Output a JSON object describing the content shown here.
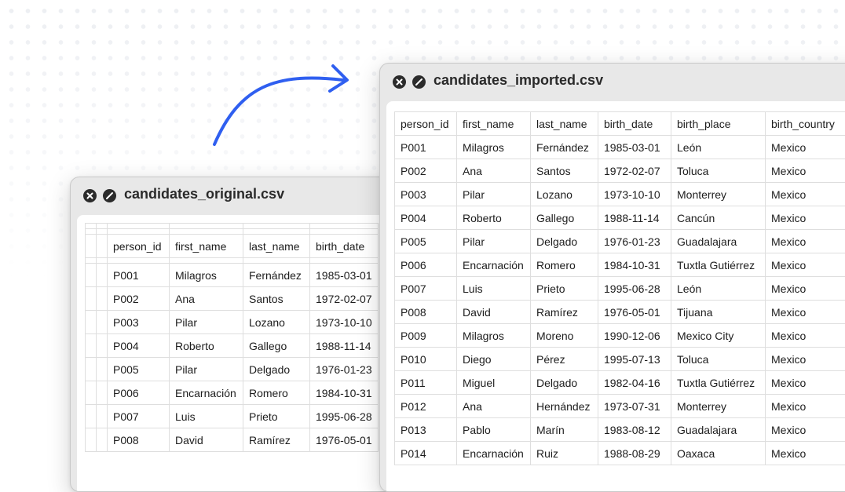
{
  "original": {
    "title": "candidates_original.csv",
    "columns": [
      "person_id",
      "first_name",
      "last_name",
      "birth_date"
    ],
    "rows": [
      [
        "P001",
        "Milagros",
        "Fernández",
        "1985-03-01"
      ],
      [
        "P002",
        "Ana",
        "Santos",
        "1972-02-07"
      ],
      [
        "P003",
        "Pilar",
        "Lozano",
        "1973-10-10"
      ],
      [
        "P004",
        "Roberto",
        "Gallego",
        "1988-11-14"
      ],
      [
        "P005",
        "Pilar",
        "Delgado",
        "1976-01-23"
      ],
      [
        "P006",
        "Encarnación",
        "Romero",
        "1984-10-31"
      ],
      [
        "P007",
        "Luis",
        "Prieto",
        "1995-06-28"
      ],
      [
        "P008",
        "David",
        "Ramírez",
        "1976-05-01"
      ]
    ]
  },
  "imported": {
    "title": "candidates_imported.csv",
    "columns": [
      "person_id",
      "first_name",
      "last_name",
      "birth_date",
      "birth_place",
      "birth_country"
    ],
    "rows": [
      [
        "P001",
        "Milagros",
        "Fernández",
        "1985-03-01",
        "León",
        "Mexico"
      ],
      [
        "P002",
        "Ana",
        "Santos",
        "1972-02-07",
        "Toluca",
        "Mexico"
      ],
      [
        "P003",
        "Pilar",
        "Lozano",
        "1973-10-10",
        "Monterrey",
        "Mexico"
      ],
      [
        "P004",
        "Roberto",
        "Gallego",
        "1988-11-14",
        "Cancún",
        "Mexico"
      ],
      [
        "P005",
        "Pilar",
        "Delgado",
        "1976-01-23",
        "Guadalajara",
        "Mexico"
      ],
      [
        "P006",
        "Encarnación",
        "Romero",
        "1984-10-31",
        "Tuxtla Gutiérrez",
        "Mexico"
      ],
      [
        "P007",
        "Luis",
        "Prieto",
        "1995-06-28",
        "León",
        "Mexico"
      ],
      [
        "P008",
        "David",
        "Ramírez",
        "1976-05-01",
        "Tijuana",
        "Mexico"
      ],
      [
        "P009",
        "Milagros",
        "Moreno",
        "1990-12-06",
        "Mexico City",
        "Mexico"
      ],
      [
        "P010",
        "Diego",
        "Pérez",
        "1995-07-13",
        "Toluca",
        "Mexico"
      ],
      [
        "P011",
        "Miguel",
        "Delgado",
        "1982-04-16",
        "Tuxtla Gutiérrez",
        "Mexico"
      ],
      [
        "P012",
        "Ana",
        "Hernández",
        "1973-07-31",
        "Monterrey",
        "Mexico"
      ],
      [
        "P013",
        "Pablo",
        "Marín",
        "1983-08-12",
        "Guadalajara",
        "Mexico"
      ],
      [
        "P014",
        "Encarnación",
        "Ruiz",
        "1988-08-29",
        "Oaxaca",
        "Mexico"
      ]
    ]
  },
  "colors": {
    "arrow": "#2f5ff0",
    "window_chrome": "#e8e8e8",
    "grid_line": "#dedede"
  },
  "icons": {
    "close": "close-icon",
    "stop": "stop-icon"
  }
}
